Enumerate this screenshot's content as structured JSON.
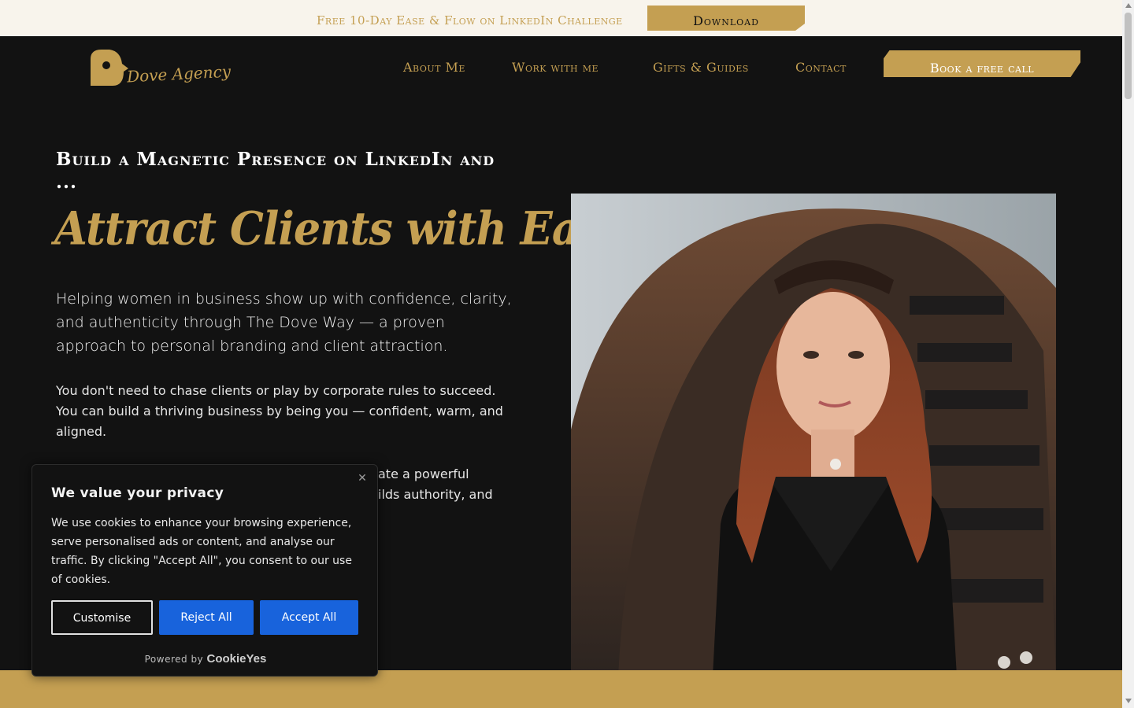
{
  "announcement": {
    "text": "Free 10-Day Ease & Flow on LinkedIn Challenge",
    "button_label": "Download"
  },
  "header": {
    "logo_text": "Dove Agency",
    "nav": [
      "About Me",
      "Work with me",
      "Gifts & Guides",
      "Contact"
    ],
    "cta_label": "Book a free call"
  },
  "hero": {
    "eyebrow": "Build a Magnetic Presence on LinkedIn and ...",
    "title": "Attract Clients with Ease",
    "lead": "Helping women in business show up with confidence, clarity, and authenticity through The Dove Way — a proven approach to personal branding and client attraction.",
    "paragraph_1": "You don't need to chase clients or play by corporate rules to succeed. You can build a thriving business by being you — confident, warm, and aligned.",
    "paragraph_2_visible_line_1": "ate a powerful",
    "paragraph_2_visible_line_2": "ilds authority, and"
  },
  "cookie_banner": {
    "title": "We value your privacy",
    "body": "We use cookies to enhance your browsing experience, serve personalised ads or content, and analyse our traffic. By clicking \"Accept All\", you consent to our use of cookies.",
    "customise_label": "Customise",
    "reject_label": "Reject All",
    "accept_label": "Accept All",
    "powered_by": "Powered by",
    "powered_brand": "CookieYes",
    "close_icon": "close-icon"
  },
  "colors": {
    "gold": "#c49f52",
    "dark_bg": "#121212",
    "cream": "#f8f4ec",
    "cookie_blue": "#1863dc"
  }
}
